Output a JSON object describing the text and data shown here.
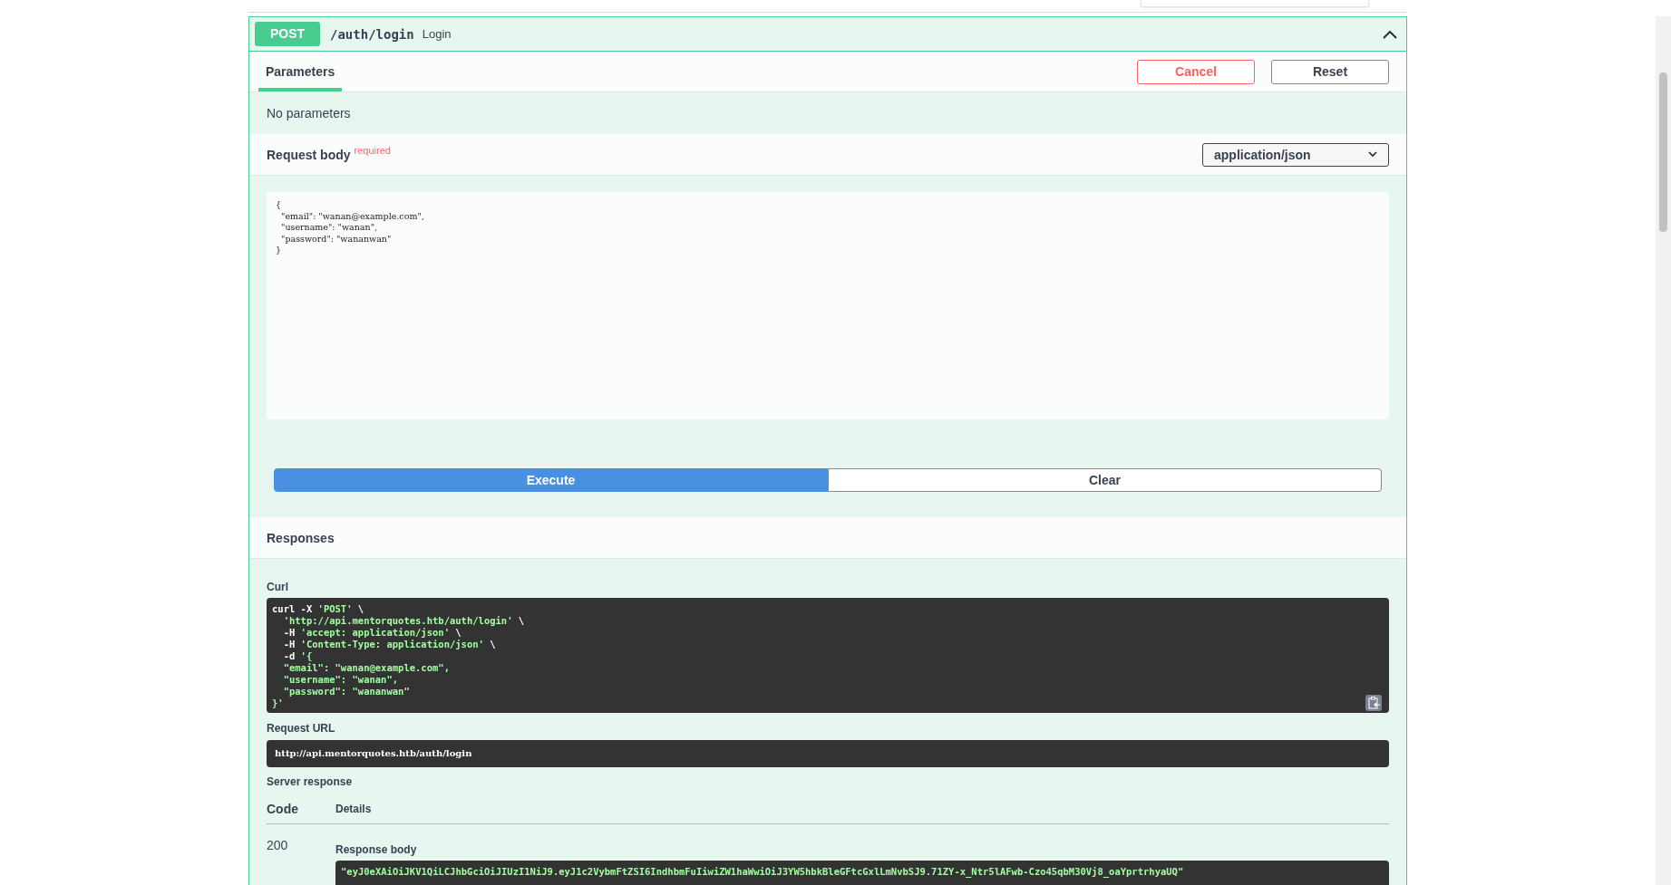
{
  "operation": {
    "method": "POST",
    "path": "/auth/login",
    "summary": "Login",
    "expanded": true
  },
  "tabs": [
    {
      "label": "Parameters",
      "selected": true
    }
  ],
  "actions": {
    "cancel": "Cancel",
    "reset": "Reset"
  },
  "parameters_message": "No parameters",
  "request_body": {
    "title": "Request body",
    "required_label": "required",
    "content_type": "application/json",
    "value": "{\n  \"email\": \"wanan@example.com\",\n  \"username\": \"wanan\",\n  \"password\": \"wananwan\"\n}"
  },
  "execute": "Execute",
  "clear": "Clear",
  "responses": {
    "title": "Responses",
    "curl_label": "Curl",
    "curl_lines": [
      [
        {
          "text": "curl -X ",
          "kind": "plain"
        },
        {
          "text": "'POST'",
          "kind": "string"
        },
        {
          "text": " \\",
          "kind": "plain"
        }
      ],
      [
        {
          "text": "  'http://api.mentorquotes.htb/auth/login'",
          "kind": "string"
        },
        {
          "text": " \\",
          "kind": "plain"
        }
      ],
      [
        {
          "text": "  -H ",
          "kind": "plain"
        },
        {
          "text": "'accept: application/json'",
          "kind": "string"
        },
        {
          "text": " \\",
          "kind": "plain"
        }
      ],
      [
        {
          "text": "  -H ",
          "kind": "plain"
        },
        {
          "text": "'Content-Type: application/json'",
          "kind": "string"
        },
        {
          "text": " \\",
          "kind": "plain"
        }
      ],
      [
        {
          "text": "  -d ",
          "kind": "plain"
        },
        {
          "text": "'{",
          "kind": "string"
        }
      ],
      [
        {
          "text": "  \"email\": \"wanan@example.com\",",
          "kind": "string"
        }
      ],
      [
        {
          "text": "  \"username\": \"wanan\",",
          "kind": "string"
        }
      ],
      [
        {
          "text": "  \"password\": \"wananwan\"",
          "kind": "string"
        }
      ],
      [
        {
          "text": "}'",
          "kind": "string"
        }
      ]
    ],
    "request_url_label": "Request URL",
    "request_url": "http://api.mentorquotes.htb/auth/login",
    "server_response_label": "Server response",
    "columns": [
      "Code",
      "Details"
    ],
    "rows": [
      {
        "code": "200",
        "response_body_label": "Response body",
        "response_body": "\"eyJ0eXAiOiJKV1QiLCJhbGciOiJIUzI1NiJ9.eyJ1c2VybmFtZSI6IndhbmFuIiwiZW1haWwiOiJ3YW5hbkBleGFtcGxlLmNvbSJ9.71ZY-x_Ntr5lAFwb-Czo45qbM30Vj8_oaYprtrhyaUQ\""
      }
    ]
  }
}
